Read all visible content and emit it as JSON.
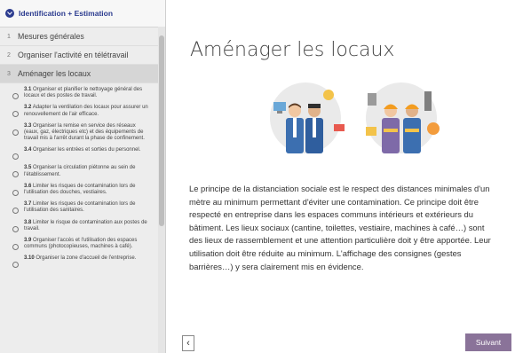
{
  "sidebar": {
    "title": "Identification + Estimation",
    "items": [
      {
        "num": "1",
        "label": "Mesures générales"
      },
      {
        "num": "2",
        "label": "Organiser l'activité en télétravail"
      },
      {
        "num": "3",
        "label": "Aménager les locaux"
      }
    ],
    "subs": [
      {
        "num": "3.1",
        "text": "Organiser et planifier le nettoyage général des locaux et des postes de travail."
      },
      {
        "num": "3.2",
        "text": "Adapter la ventilation des locaux pour assurer un renouvellement de l'air efficace."
      },
      {
        "num": "3.3",
        "text": "Organiser la remise en service des réseaux (eaux, gaz, électriques etc) et des équipements de travail mis à l'arrêt durant la phase de confinement."
      },
      {
        "num": "3.4",
        "text": "Organiser les entrées et sorties du personnel."
      },
      {
        "num": "3.5",
        "text": "Organiser la circulation piétonne au sein de l'établissement."
      },
      {
        "num": "3.6",
        "text": "Limiter les risques de contamination lors de l'utilisation des douches, vestiaires."
      },
      {
        "num": "3.7",
        "text": "Limiter les risques de contamination lors de l'utilisation des sanitaires."
      },
      {
        "num": "3.8",
        "text": "Limiter le risque de contamination aux postes de travail."
      },
      {
        "num": "3.9",
        "text": "Organiser l'accès et l'utilisation des espaces communs (photocopieuses, machines à café)."
      },
      {
        "num": "3.10",
        "text": "Organiser la zone d'accueil de l'entreprise."
      }
    ]
  },
  "main": {
    "title": "Aménager les locaux",
    "body": "Le principe de la distanciation sociale est le respect des distances minimales d'un mètre au minimum permettant d'éviter une contamination. Ce principe doit être respecté en entreprise dans les espaces communs intérieurs et extérieurs du bâtiment. Les lieux sociaux (cantine, toilettes, vestiaire, machines à café…) sont des lieux de rassemblement et une attention particulière doit y être apportée. Leur utilisation doit être réduite au minimum. L'affichage des consignes (gestes barrières…) y sera clairement mis en évidence.",
    "prev_label": "‹",
    "next_label": "Suivant"
  },
  "colors": {
    "accent": "#2b3b8f",
    "next_button": "#8a7399",
    "sidebar_bg": "#ededed"
  },
  "icons": [
    "chevron-down-icon",
    "circle-icon",
    "chevron-left-icon",
    "office-workers-illustration",
    "industrial-workers-illustration"
  ]
}
